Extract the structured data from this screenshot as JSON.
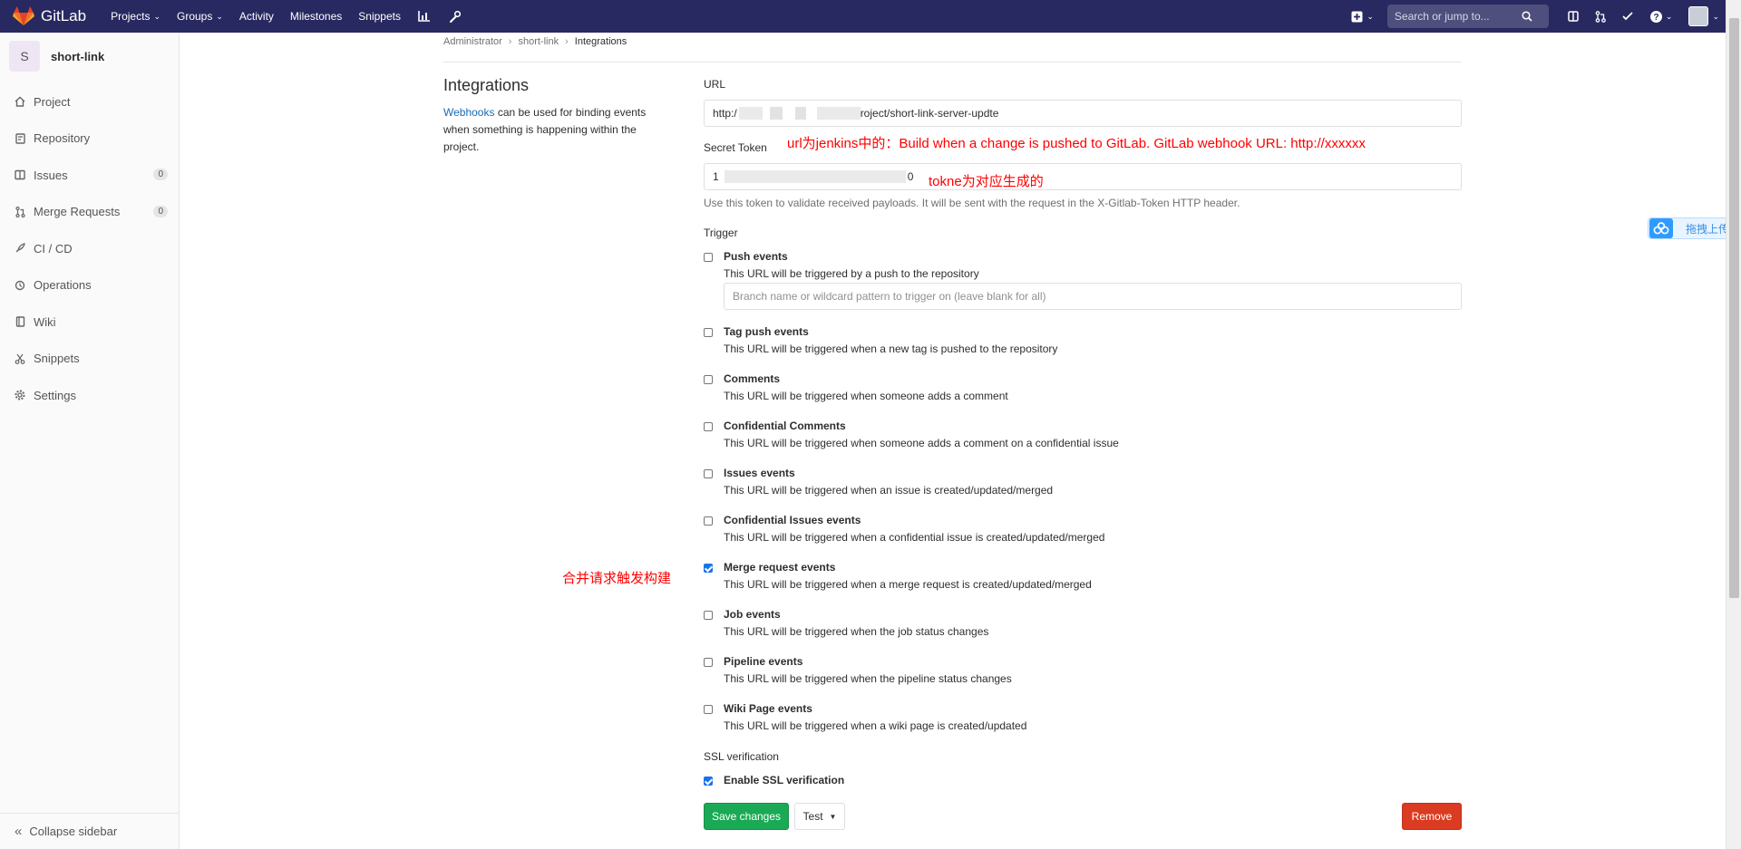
{
  "navbar": {
    "brand": "GitLab",
    "links": [
      {
        "label": "Projects",
        "caret": true
      },
      {
        "label": "Groups",
        "caret": true
      },
      {
        "label": "Activity",
        "caret": false
      },
      {
        "label": "Milestones",
        "caret": false
      },
      {
        "label": "Snippets",
        "caret": false
      }
    ],
    "search_placeholder": "Search or jump to...",
    "bg_color": "#292961"
  },
  "sidebar": {
    "project_initial": "S",
    "project_name": "short-link",
    "items": [
      {
        "label": "Project",
        "icon": "home-icon",
        "count": null
      },
      {
        "label": "Repository",
        "icon": "doc-icon",
        "count": null
      },
      {
        "label": "Issues",
        "icon": "issues-icon",
        "count": "0"
      },
      {
        "label": "Merge Requests",
        "icon": "merge-request-icon",
        "count": "0"
      },
      {
        "label": "CI / CD",
        "icon": "rocket-icon",
        "count": null
      },
      {
        "label": "Operations",
        "icon": "cloud-icon",
        "count": null
      },
      {
        "label": "Wiki",
        "icon": "book-icon",
        "count": null
      },
      {
        "label": "Snippets",
        "icon": "scissors-icon",
        "count": null
      },
      {
        "label": "Settings",
        "icon": "gear-icon",
        "count": null
      }
    ],
    "collapse_label": "Collapse sidebar"
  },
  "breadcrumb": [
    "Administrator",
    "short-link",
    "Integrations"
  ],
  "intro": {
    "title": "Integrations",
    "link_text": "Webhooks",
    "text": " can be used for binding events when something is happening within the project."
  },
  "form": {
    "url_label": "URL",
    "url_prefix": "http:/",
    "url_suffix": "roject/short-link-server-updte",
    "token_label": "Secret Token",
    "token_prefix": "1",
    "token_suffix": "0",
    "token_help": "Use this token to validate received payloads. It will be sent with the request in the X-Gitlab-Token HTTP header.",
    "trigger_label": "Trigger",
    "branch_placeholder": "Branch name or wildcard pattern to trigger on (leave blank for all)",
    "triggers": [
      {
        "title": "Push events",
        "desc": "This URL will be triggered by a push to the repository",
        "checked": false
      },
      {
        "title": "Tag push events",
        "desc": "This URL will be triggered when a new tag is pushed to the repository",
        "checked": false
      },
      {
        "title": "Comments",
        "desc": "This URL will be triggered when someone adds a comment",
        "checked": false
      },
      {
        "title": "Confidential Comments",
        "desc": "This URL will be triggered when someone adds a comment on a confidential issue",
        "checked": false
      },
      {
        "title": "Issues events",
        "desc": "This URL will be triggered when an issue is created/updated/merged",
        "checked": false
      },
      {
        "title": "Confidential Issues events",
        "desc": "This URL will be triggered when a confidential issue is created/updated/merged",
        "checked": false
      },
      {
        "title": "Merge request events",
        "desc": "This URL will be triggered when a merge request is created/updated/merged",
        "checked": true
      },
      {
        "title": "Job events",
        "desc": "This URL will be triggered when the job status changes",
        "checked": false
      },
      {
        "title": "Pipeline events",
        "desc": "This URL will be triggered when the pipeline status changes",
        "checked": false
      },
      {
        "title": "Wiki Page events",
        "desc": "This URL will be triggered when a wiki page is created/updated",
        "checked": false
      }
    ],
    "ssl_label": "SSL verification",
    "ssl_checkbox": "Enable SSL verification",
    "ssl_checked": true,
    "save_label": "Save changes",
    "test_label": "Test",
    "remove_label": "Remove"
  },
  "annotations": {
    "url_note": "url为jenkins中的：Build when a change is pushed to GitLab. GitLab webhook URL: http://xxxxxx",
    "token_note": "tokne为对应生成的",
    "merge_note": "合并请求触发构建"
  },
  "upload_widget": {
    "label": "拖拽上传"
  },
  "colors": {
    "save": "#1aaa55",
    "remove": "#db3b21",
    "link": "#1b69b6",
    "annotation": "#ff0000"
  }
}
